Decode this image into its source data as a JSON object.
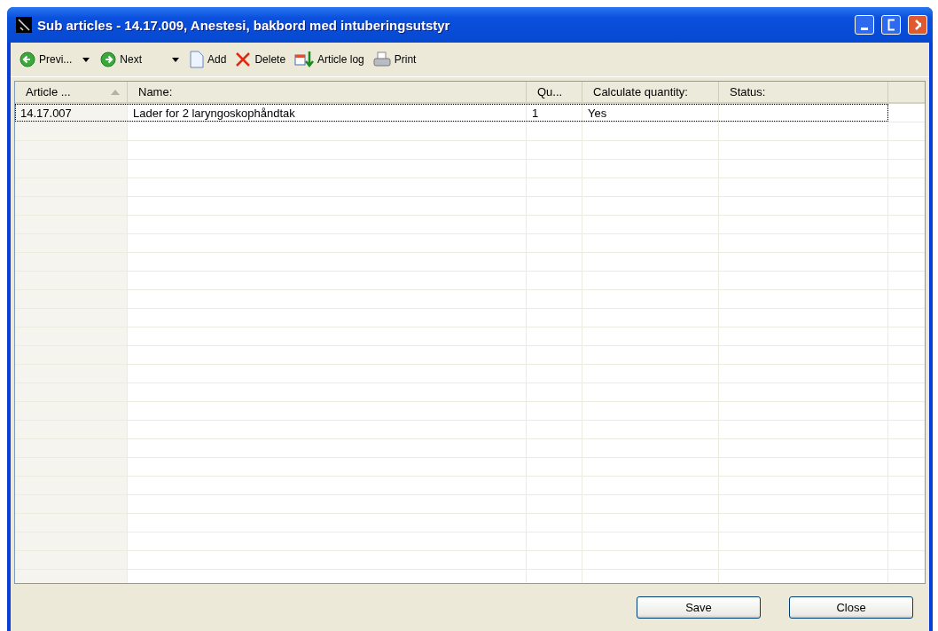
{
  "window": {
    "title": "Sub articles - 14.17.009, Anestesi, bakbord med intuberingsutstyr"
  },
  "toolbar": [
    {
      "kind": "back",
      "label": "Previ...",
      "dropdown": true
    },
    {
      "kind": "forward",
      "label": "Next",
      "dropdown": true
    },
    {
      "kind": "add",
      "label": "Add",
      "dropdown": false
    },
    {
      "kind": "delete",
      "label": "Delete",
      "dropdown": false
    },
    {
      "kind": "log",
      "label": "Article log",
      "dropdown": false
    },
    {
      "kind": "print",
      "label": "Print",
      "dropdown": false
    }
  ],
  "table": {
    "columns": [
      {
        "label": "Article ...",
        "sorted": true
      },
      {
        "label": "Name:",
        "sorted": false
      },
      {
        "label": "Qu...",
        "sorted": false
      },
      {
        "label": "Calculate quantity:",
        "sorted": false
      },
      {
        "label": "Status:",
        "sorted": false
      }
    ],
    "rows": [
      {
        "cells": [
          "14.17.007",
          "Lader for 2 laryngoskophåndtak",
          "1",
          "Yes",
          ""
        ],
        "selected": true
      }
    ]
  },
  "buttons": [
    "Save",
    "Close"
  ]
}
